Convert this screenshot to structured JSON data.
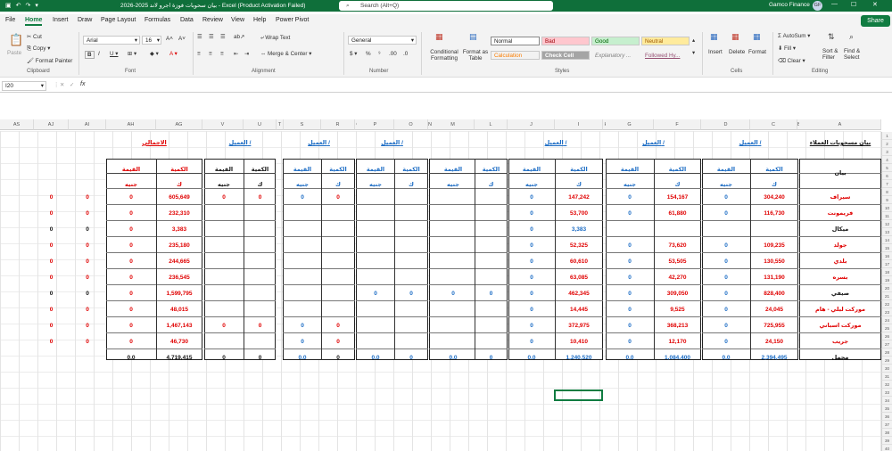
{
  "titlebar": {
    "title": "بيان سحوبات فوزة اجرو لاند 2025-2026 - Excel (Product Activation Failed)",
    "search_placeholder": "Search (Alt+Q)",
    "user_name": "Gamco Finance",
    "user_initials": "GF"
  },
  "menu": {
    "tabs": [
      "File",
      "Home",
      "Insert",
      "Draw",
      "Page Layout",
      "Formulas",
      "Data",
      "Review",
      "View",
      "Help",
      "Power Pivot"
    ],
    "active": "Home",
    "share": "Share"
  },
  "ribbon": {
    "clipboard": {
      "paste": "Paste",
      "cut": "Cut",
      "copy": "Copy",
      "format_painter": "Format Painter",
      "label": "Clipboard"
    },
    "font": {
      "name": "Arial",
      "size": "16",
      "label": "Font"
    },
    "alignment": {
      "wrap": "Wrap Text",
      "merge": "Merge & Center",
      "label": "Alignment"
    },
    "number": {
      "format": "General",
      "label": "Number"
    },
    "styles": {
      "conditional": "Conditional Formatting",
      "format_table": "Format as Table",
      "normal": "Normal",
      "bad": "Bad",
      "good": "Good",
      "neutral": "Neutral",
      "calculation": "Calculation",
      "check_cell": "Check Cell",
      "explanatory": "Explanatory ...",
      "followed": "Followed Hy...",
      "label": "Styles"
    },
    "cells": {
      "insert": "Insert",
      "delete": "Delete",
      "format": "Format",
      "label": "Cells"
    },
    "editing": {
      "autosum": "AutoSum",
      "fill": "Fill",
      "clear": "Clear",
      "sort": "Sort & Filter",
      "find": "Find & Select",
      "label": "Editing"
    }
  },
  "formula": {
    "cell_ref": "I20",
    "fx": "fx",
    "content": ""
  },
  "columns": [
    "AS",
    "AJ",
    "AI",
    "AH",
    "AG",
    "V",
    "U",
    "T",
    "S",
    "R",
    "Q",
    "P",
    "O",
    "N",
    "M",
    "L",
    "K",
    "J",
    "I",
    "H",
    "G",
    "F",
    "E",
    "D",
    "C",
    "B",
    "A"
  ],
  "rows": [
    "1",
    "2",
    "3",
    "4",
    "5",
    "6",
    "7",
    "8",
    "9",
    "10",
    "11",
    "12",
    "13",
    "14",
    "15",
    "16",
    "17",
    "18",
    "19",
    "20",
    "21",
    "22",
    "23",
    "24",
    "25",
    "26",
    "27",
    "28",
    "29",
    "30",
    "31",
    "32",
    "33",
    "34",
    "35",
    "36",
    "37",
    "38",
    "39",
    "40"
  ],
  "sheet": {
    "main_title": "بيان مسحوبات العملاء",
    "bayan": "بيان",
    "sections": [
      "العميل /",
      "العميل /",
      "العميل /",
      "العميل /",
      "العميل /",
      "العميل /",
      "العميل /",
      "الاجمالي"
    ],
    "qty": "الكمية",
    "value": "القيمة",
    "kg": "ك",
    "egp": "جنيه",
    "row_labels": [
      "سيراف",
      "فريمونت",
      "ميكال",
      "جولد",
      "بلدي",
      "بسره",
      "صيفي",
      "موركت لبلي - هام",
      "موركت اسباني",
      "جريب",
      "مجمل"
    ],
    "colC": [
      "304,240",
      "116,730",
      "",
      "109,235",
      "130,550",
      "131,190",
      "828,400",
      "24,045",
      "725,955",
      "24,150",
      "2,394,495"
    ],
    "colD": [
      "0",
      "0",
      "",
      "0",
      "0",
      "0",
      "0",
      "0",
      "0",
      "0",
      "0.0"
    ],
    "colF": [
      "154,167",
      "61,880",
      "",
      "73,620",
      "53,505",
      "42,270",
      "309,050",
      "9,525",
      "368,213",
      "12,170",
      "1,084,400"
    ],
    "colG": [
      "0",
      "0",
      "",
      "0",
      "0",
      "0",
      "0",
      "0",
      "0",
      "0",
      "0.0"
    ],
    "colI": [
      "147,242",
      "53,700",
      "3,383",
      "52,325",
      "60,610",
      "63,085",
      "462,345",
      "14,445",
      "372,975",
      "10,410",
      "1,240,520"
    ],
    "colJ": [
      "0",
      "0",
      "0",
      "0",
      "0",
      "0",
      "0",
      "0",
      "0",
      "0",
      "0.0"
    ],
    "colL": [
      "",
      "",
      "",
      "",
      "",
      "",
      "0",
      "",
      "",
      "",
      "0"
    ],
    "colM": [
      "",
      "",
      "",
      "",
      "",
      "",
      "0",
      "",
      "",
      "",
      "0.0"
    ],
    "colO": [
      "",
      "",
      "",
      "",
      "",
      "",
      "0",
      "",
      "",
      "",
      "0"
    ],
    "colP": [
      "",
      "",
      "",
      "",
      "",
      "",
      "0",
      "",
      "",
      "",
      "0.0"
    ],
    "colR": [
      "0",
      "",
      "",
      "",
      "",
      "",
      "",
      "",
      "0",
      "0",
      "0"
    ],
    "colS": [
      "0",
      "",
      "",
      "",
      "",
      "",
      "",
      "",
      "0",
      "0",
      "0.0"
    ],
    "colU": [
      "0",
      "",
      "",
      "",
      "",
      "",
      "",
      "",
      "0",
      "",
      "0"
    ],
    "colV": [
      "0",
      "",
      "",
      "",
      "",
      "",
      "",
      "",
      "0",
      "",
      "0"
    ],
    "colAG": [
      "605,649",
      "232,310",
      "3,383",
      "235,180",
      "244,665",
      "236,545",
      "1,599,795",
      "48,015",
      "1,467,143",
      "46,730",
      "4,719,415"
    ],
    "colAH": [
      "0",
      "0",
      "0",
      "0",
      "0",
      "0",
      "0",
      "0",
      "0",
      "0",
      "0.0"
    ],
    "colAI": [
      "0",
      "0",
      "0",
      "0",
      "0",
      "0",
      "0",
      "0",
      "0",
      "0"
    ],
    "colAJ": [
      "0",
      "0",
      "0",
      "0",
      "0",
      "0",
      "0",
      "0",
      "0",
      "0"
    ]
  }
}
